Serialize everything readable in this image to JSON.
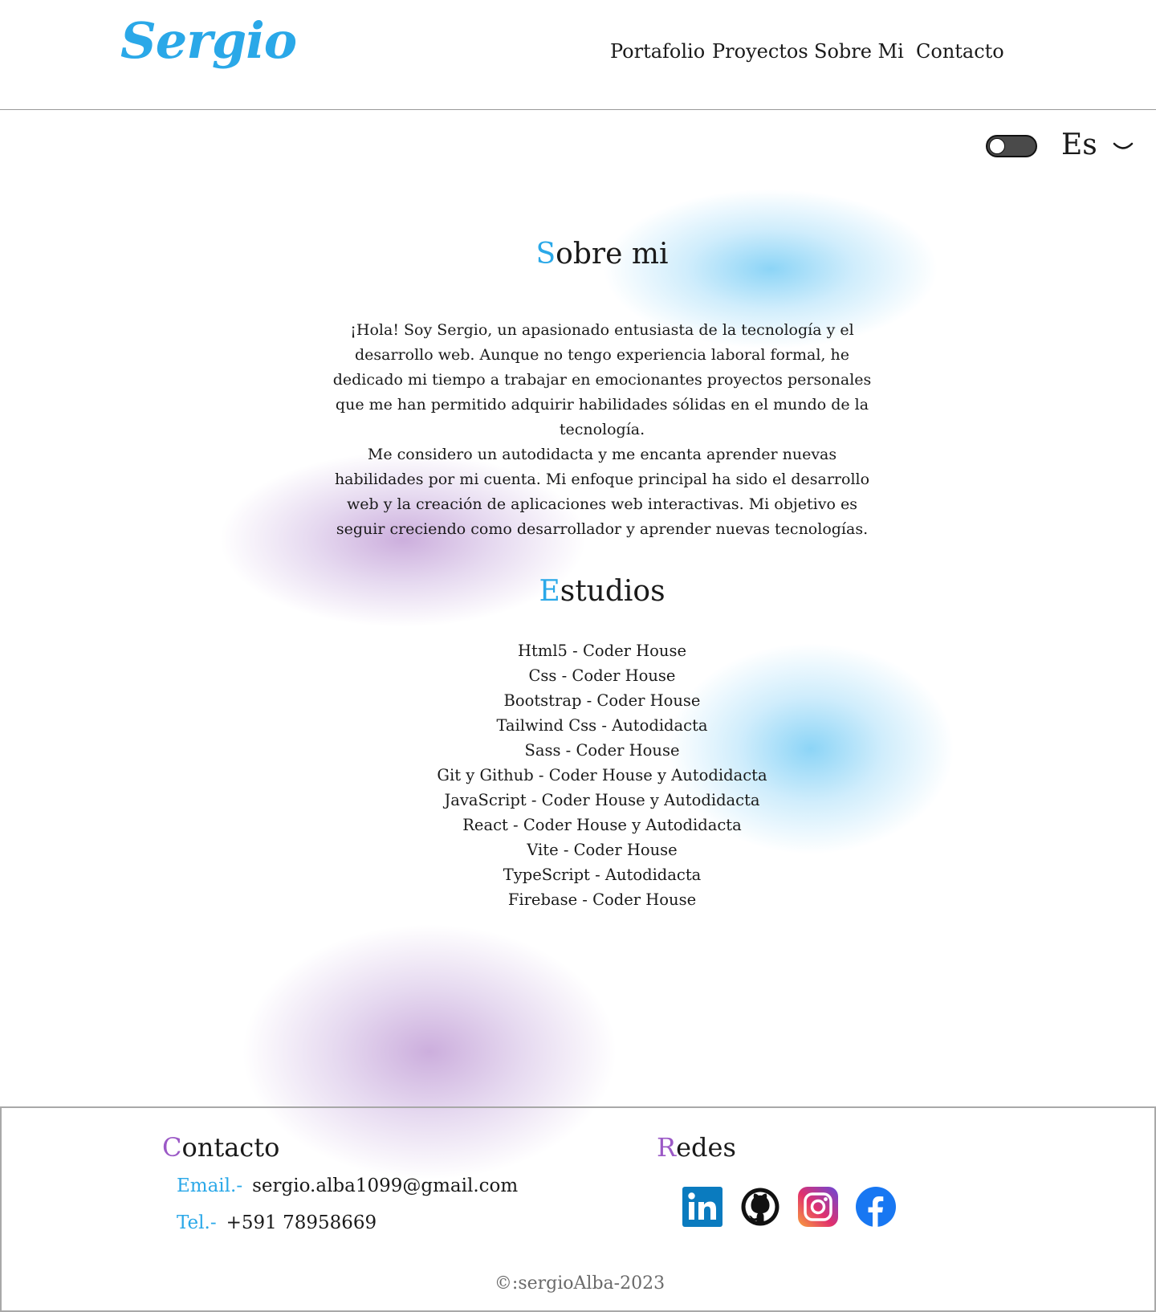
{
  "header": {
    "logo": "Sergio",
    "nav": [
      "Portafolio",
      "Proyectos",
      "Sobre Mi",
      "Contacto"
    ]
  },
  "controls": {
    "theme_toggle": "off",
    "language": "Es"
  },
  "about": {
    "title_initial": "S",
    "title_rest": "obre mi",
    "paragraphs": [
      "¡Hola! Soy Sergio, un apasionado entusiasta de la tecnología y el desarrollo web. Aunque no tengo experiencia laboral formal, he dedicado mi tiempo a trabajar en emocionantes proyectos personales que me han permitido adquirir habilidades sólidas en el mundo de la tecnología.",
      "Me considero un autodidacta y me encanta aprender nuevas habilidades por mi cuenta. Mi enfoque principal ha sido el desarrollo web y la creación de aplicaciones web interactivas. Mi objetivo es seguir creciendo como desarrollador y aprender nuevas tecnologías."
    ]
  },
  "studies": {
    "title_initial": "E",
    "title_rest": "studios",
    "items": [
      "Html5 - Coder House",
      "Css - Coder House",
      "Bootstrap - Coder House",
      "Tailwind Css - Autodidacta",
      "Sass - Coder House",
      "Git y Github - Coder House y Autodidacta",
      "JavaScript - Coder House y Autodidacta",
      "React - Coder House y Autodidacta",
      "Vite - Coder House",
      "TypeScript  - Autodidacta",
      "Firebase - Coder House"
    ]
  },
  "footer": {
    "contact_initial": "C",
    "contact_rest": "ontacto",
    "email_label": "Email.-",
    "email": "sergio.alba1099@gmail.com",
    "tel_label": "Tel.-",
    "tel": "+591 78958669",
    "social_initial": "R",
    "social_rest": "edes",
    "socials": [
      "linkedin-icon",
      "github-icon",
      "instagram-icon",
      "facebook-icon"
    ],
    "copyright": "©:sergioAlba-2023"
  },
  "colors": {
    "accent_blue": "#2aa8e8",
    "accent_purple": "#9b59c6",
    "toggle_track": "#4a4a4a"
  }
}
